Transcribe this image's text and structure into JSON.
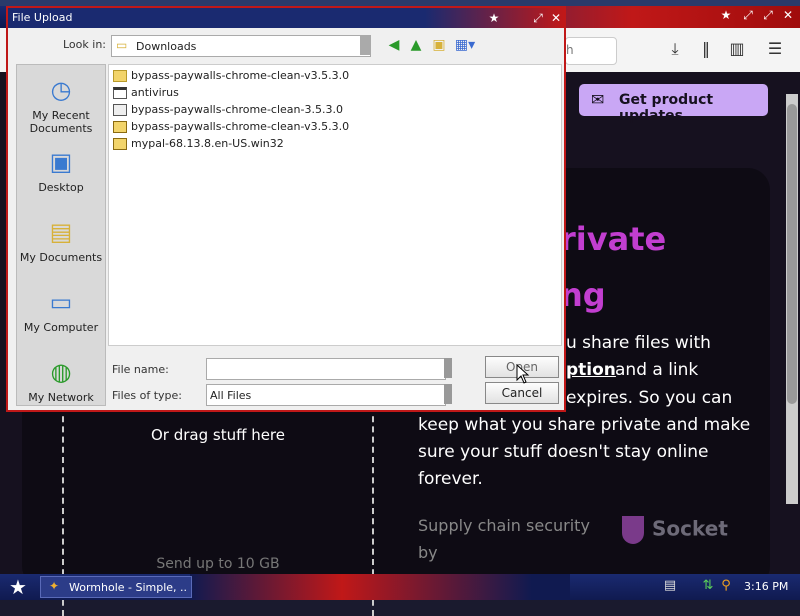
{
  "browser": {
    "url_fragment": "h",
    "toolbar_icons": [
      "download-icon",
      "library-icon",
      "sidebar-icon",
      "menu-icon"
    ]
  },
  "page": {
    "promo_button": "Get product updates",
    "hero_fragment_1": "rivate",
    "hero_fragment_2": "ng",
    "body_fragments": [
      "u share files with",
      "ption",
      "and a link",
      "expires. So you can",
      "keep what you share private and make",
      "sure your stuff doesn't stay online",
      "forever."
    ],
    "drag_text": "Or drag stuff here",
    "send_text": "Send up to 10 GB",
    "supply_chain": "Supply chain security by",
    "socket_logo": "Socket"
  },
  "dialog": {
    "title": "File Upload",
    "look_in_label": "Look in:",
    "look_in_value": "Downloads",
    "places": [
      {
        "label": "My Recent Documents",
        "icon": "recent-documents-icon"
      },
      {
        "label": "Desktop",
        "icon": "desktop-icon"
      },
      {
        "label": "My Documents",
        "icon": "my-documents-icon"
      },
      {
        "label": "My Computer",
        "icon": "my-computer-icon"
      },
      {
        "label": "My Network",
        "icon": "my-network-icon"
      }
    ],
    "files": [
      {
        "name": "bypass-paywalls-chrome-clean-v3.5.3.0",
        "type": "folder"
      },
      {
        "name": "antivirus",
        "type": "exe"
      },
      {
        "name": "bypass-paywalls-chrome-clean-3.5.3.0",
        "type": "doc"
      },
      {
        "name": "bypass-paywalls-chrome-clean-v3.5.3.0",
        "type": "zip"
      },
      {
        "name": "mypal-68.13.8.en-US.win32",
        "type": "zip"
      }
    ],
    "file_name_label": "File name:",
    "file_name_value": "",
    "files_of_type_label": "Files of type:",
    "files_of_type_value": "All Files",
    "open_button": "Open",
    "cancel_button": "Cancel"
  },
  "taskbar": {
    "task_label": "Wormhole - Simple, ...",
    "clock": "3:16 PM"
  }
}
